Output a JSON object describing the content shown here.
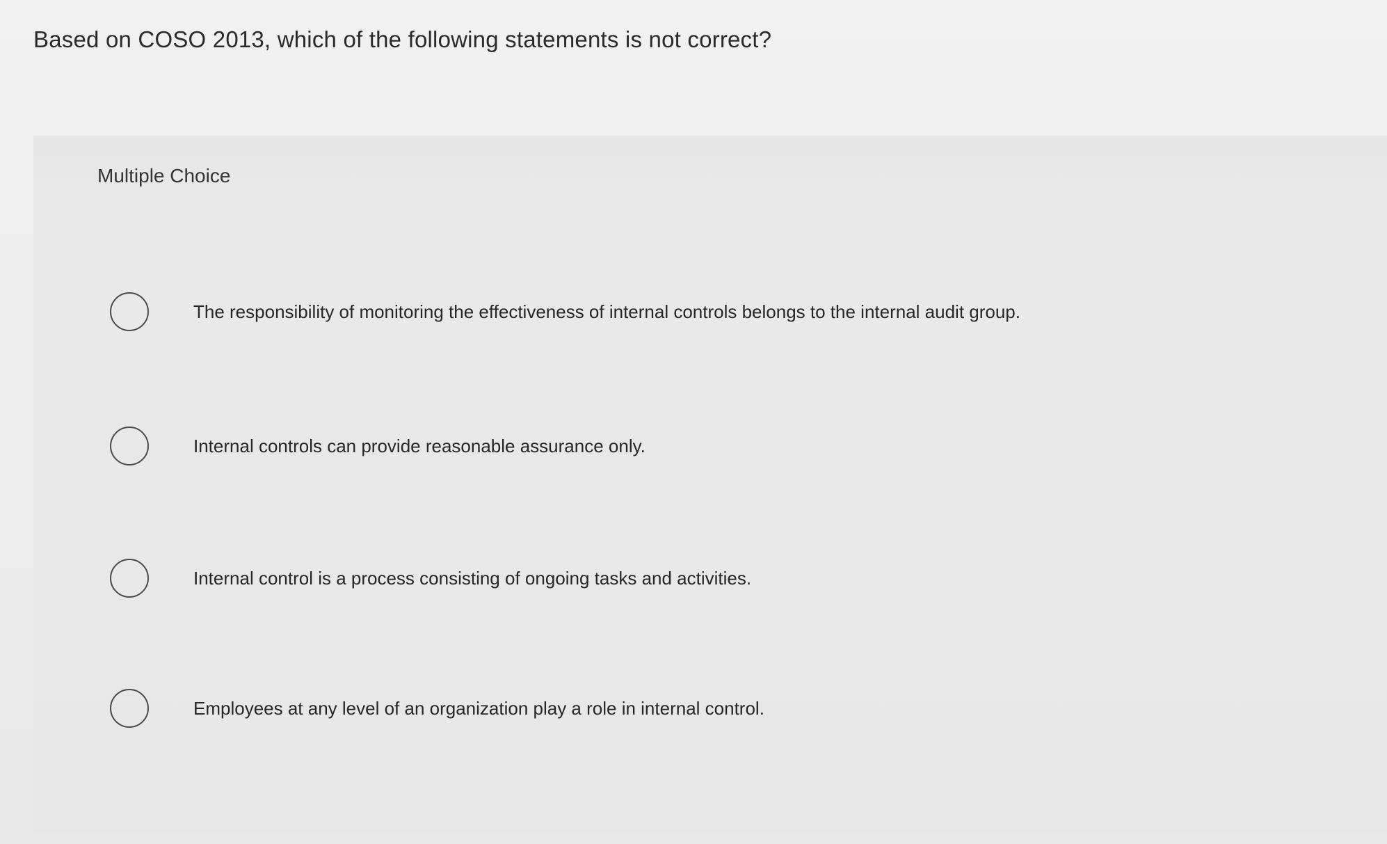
{
  "question": {
    "text": "Based on COSO 2013, which of the following statements is not correct?"
  },
  "panel": {
    "label": "Multiple Choice"
  },
  "options": [
    {
      "text": "The responsibility of monitoring the effectiveness of internal controls belongs to the internal audit group."
    },
    {
      "text": "Internal controls can provide reasonable assurance only."
    },
    {
      "text": "Internal control is a process consisting of ongoing tasks and activities."
    },
    {
      "text": "Employees at any level of an organization play a role in internal control."
    }
  ]
}
